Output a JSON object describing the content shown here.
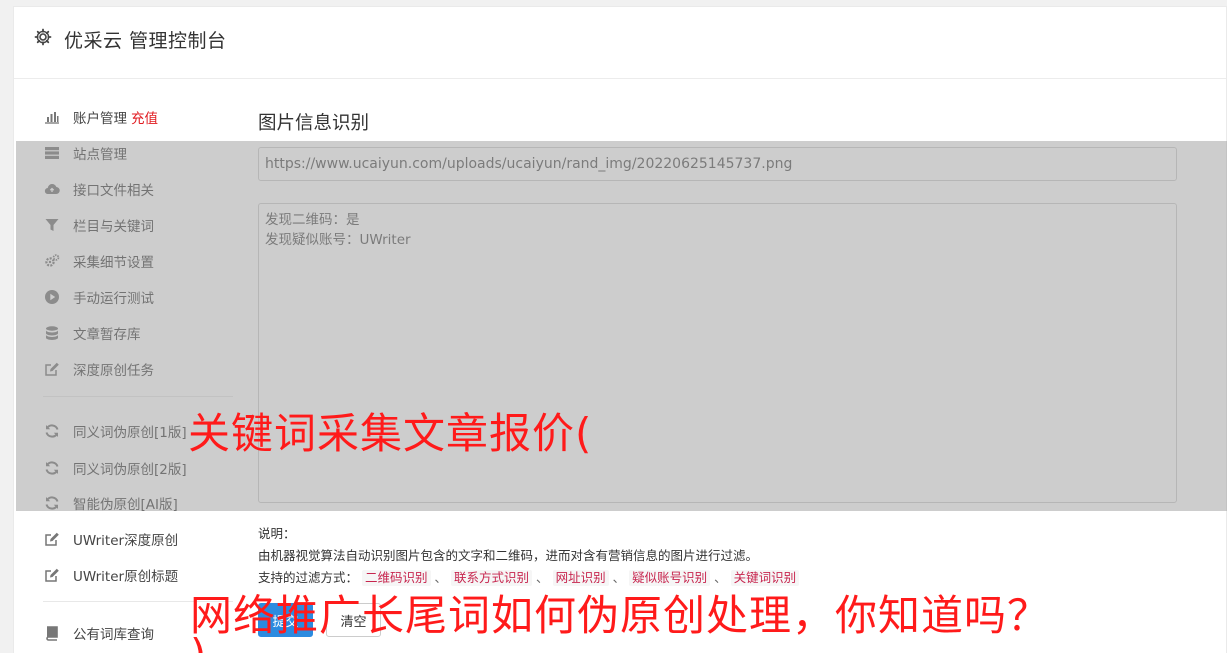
{
  "header": {
    "title": "优采云 管理控制台",
    "icon": "gear-icon"
  },
  "sidebar": {
    "items": [
      {
        "label": "账户管理",
        "extra": "充值",
        "icon": "bar-chart-icon"
      },
      {
        "label": "站点管理",
        "icon": "server-icon"
      },
      {
        "label": "接口文件相关",
        "icon": "cloud-upload-icon"
      },
      {
        "label": "栏目与关键词",
        "icon": "filter-icon"
      },
      {
        "label": "采集细节设置",
        "icon": "gears-icon"
      },
      {
        "label": "手动运行测试",
        "icon": "play-circle-icon"
      },
      {
        "label": "文章暂存库",
        "icon": "database-icon"
      },
      {
        "label": "深度原创任务",
        "icon": "edit-icon"
      },
      {
        "label": "同义词伪原创[1版]",
        "icon": "refresh-icon"
      },
      {
        "label": "同义词伪原创[2版]",
        "icon": "refresh-icon"
      },
      {
        "label": "智能伪原创[AI版]",
        "icon": "refresh-icon"
      },
      {
        "label": "UWriter深度原创",
        "icon": "edit-icon"
      },
      {
        "label": "UWriter原创标题",
        "icon": "edit-icon"
      },
      {
        "label": "公有词库查询",
        "icon": "book-icon"
      }
    ]
  },
  "main": {
    "title": "图片信息识别",
    "url_value": "https://www.ucaiyun.com/uploads/ucaiyun/rand_img/20220625145737.png",
    "result_lines": [
      "发现二维码：是",
      "发现疑似账号：UWriter"
    ],
    "notes": {
      "heading": "说明：",
      "description": "由机器视觉算法自动识别图片包含的文字和二维码，进而对含有营销信息的图片进行过滤。",
      "supported_label": "支持的过滤方式：",
      "tags": [
        "二维码识别",
        "联系方式识别",
        "网址识别",
        "疑似账号识别",
        "关键词识别"
      ],
      "separator": "、"
    },
    "submit_label": "提交",
    "clear_label": "清空"
  },
  "overlay": {
    "line1": "关键词采集文章报价(",
    "line2": "网络推广长尾词如何伪原创处理，你知道吗？",
    "line3": ")"
  },
  "colors": {
    "accent": "#2b8be0",
    "recharge": "#e0191f",
    "overlay_text": "#ff1a1a",
    "tag_text": "#c7254e"
  }
}
